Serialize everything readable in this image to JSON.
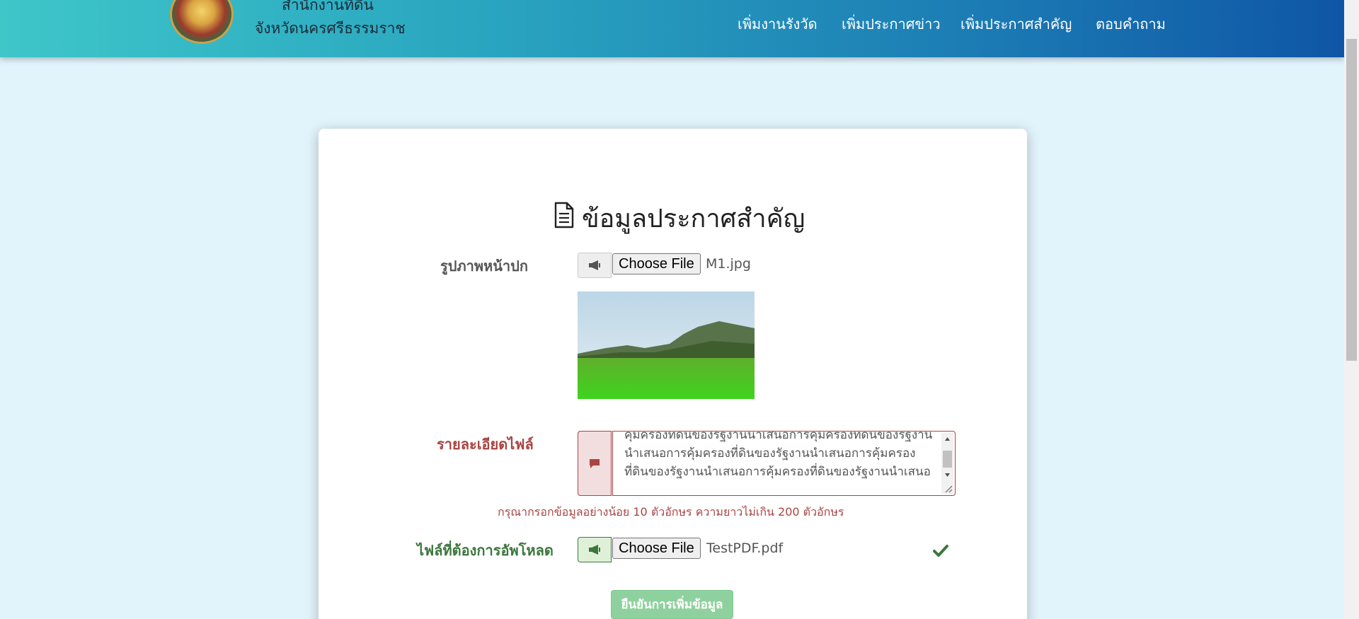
{
  "header": {
    "brand_line1": "สำนักงานที่ดิน",
    "brand_line2": "จังหวัดนครศรีธรรมราช",
    "nav": [
      {
        "label": "เพิ่มงานรังวัด"
      },
      {
        "label": "เพิ่มประกาศข่าว"
      },
      {
        "label": "เพิ่มประกาศสำคัญ"
      },
      {
        "label": "ตอบคำถาม"
      }
    ]
  },
  "form": {
    "title": "ข้อมูลประกาศสำคัญ",
    "cover": {
      "label": "รูปภาพหน้าปก",
      "button": "Choose File",
      "file_name": "M1.jpg"
    },
    "details": {
      "label": "รายละเอียดไฟล์",
      "value": "คุ้มครองที่ดินของรัฐงานนำเสนอการคุ้มครองที่ดินของรัฐงานนำเสนอการคุ้มครองที่ดินของรัฐงานนำเสนอการคุ้มครองที่ดินของรัฐงานนำเสนอการคุ้มครองที่ดินของรัฐงานนำเสนอ",
      "help": "กรุณากรอกข้อมูลอย่างน้อย 10 ตัวอักษร ความยาวไม่เกิน 200 ตัวอักษร"
    },
    "upload": {
      "label": "ไฟล์ที่ต้องการอัพโหลด",
      "button": "Choose File",
      "file_name": "TestPDF.pdf"
    },
    "submit_label": "ยืนยันการเพิ่มข้อมูล"
  },
  "colors": {
    "header_start": "#3ec6c9",
    "header_end": "#0f56a6",
    "error": "#a94442",
    "success": "#3c763d",
    "submit": "#8fd19e"
  }
}
